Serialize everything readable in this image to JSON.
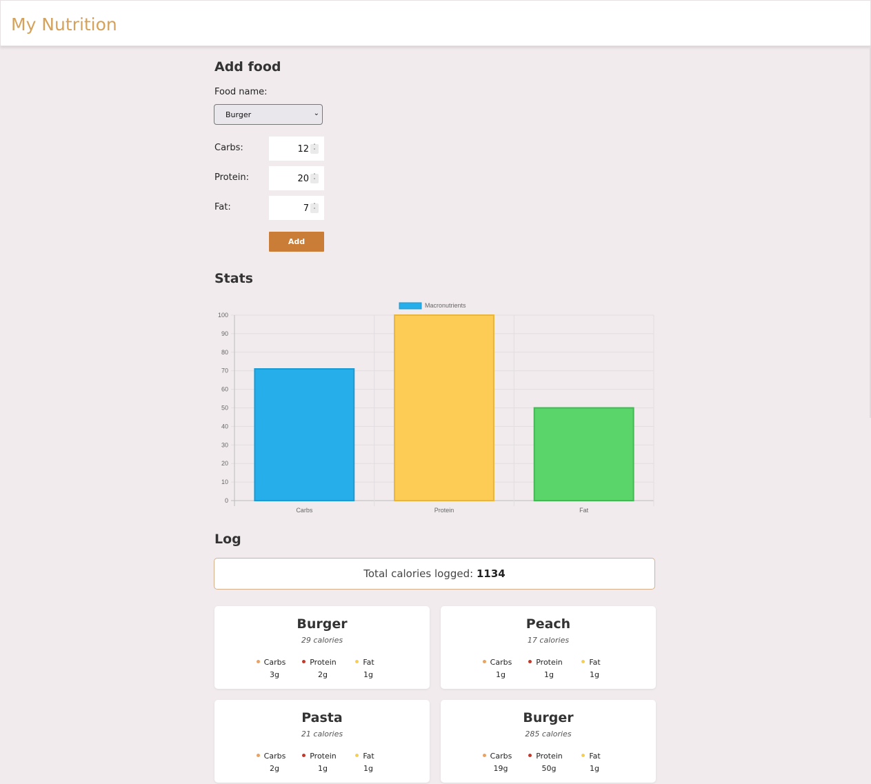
{
  "app": {
    "title": "My Nutrition"
  },
  "add_food": {
    "heading": "Add food",
    "food_name_label": "Food name:",
    "food_selected": "Burger",
    "carbs_label": "Carbs:",
    "carbs_value": "12",
    "protein_label": "Protein:",
    "protein_value": "20",
    "fat_label": "Fat:",
    "fat_value": "7",
    "add_button": "Add"
  },
  "stats": {
    "heading": "Stats"
  },
  "chart_data": {
    "type": "bar",
    "categories": [
      "Carbs",
      "Protein",
      "Fat"
    ],
    "series": [
      {
        "name": "Macronutrients",
        "values": [
          71,
          100,
          50
        ]
      }
    ],
    "colors": [
      "#25aeea",
      "#fdcc54",
      "#59d56a"
    ],
    "borders": [
      "#1d9ad2",
      "#e8b63e",
      "#43b854"
    ],
    "ylim": [
      0,
      100
    ],
    "yticks": [
      "0",
      "10",
      "20",
      "30",
      "40",
      "50",
      "60",
      "70",
      "80",
      "90",
      "100"
    ],
    "legend": "top",
    "grid": true
  },
  "log": {
    "heading": "Log",
    "total_label": "Total calories logged:",
    "total_value": "1134",
    "macro_colors": {
      "carbs": "#e8a364",
      "protein": "#c0392b",
      "fat": "#f5cf55"
    },
    "entries": [
      {
        "name": "Burger",
        "calories": "29 calories",
        "carbs": "3g",
        "protein": "2g",
        "fat": "1g"
      },
      {
        "name": "Peach",
        "calories": "17 calories",
        "carbs": "1g",
        "protein": "1g",
        "fat": "1g"
      },
      {
        "name": "Pasta",
        "calories": "21 calories",
        "carbs": "2g",
        "protein": "1g",
        "fat": "1g"
      },
      {
        "name": "Burger",
        "calories": "285 calories",
        "carbs": "19g",
        "protein": "50g",
        "fat": "1g"
      }
    ],
    "macro_labels": {
      "carbs": "Carbs",
      "protein": "Protein",
      "fat": "Fat"
    }
  }
}
